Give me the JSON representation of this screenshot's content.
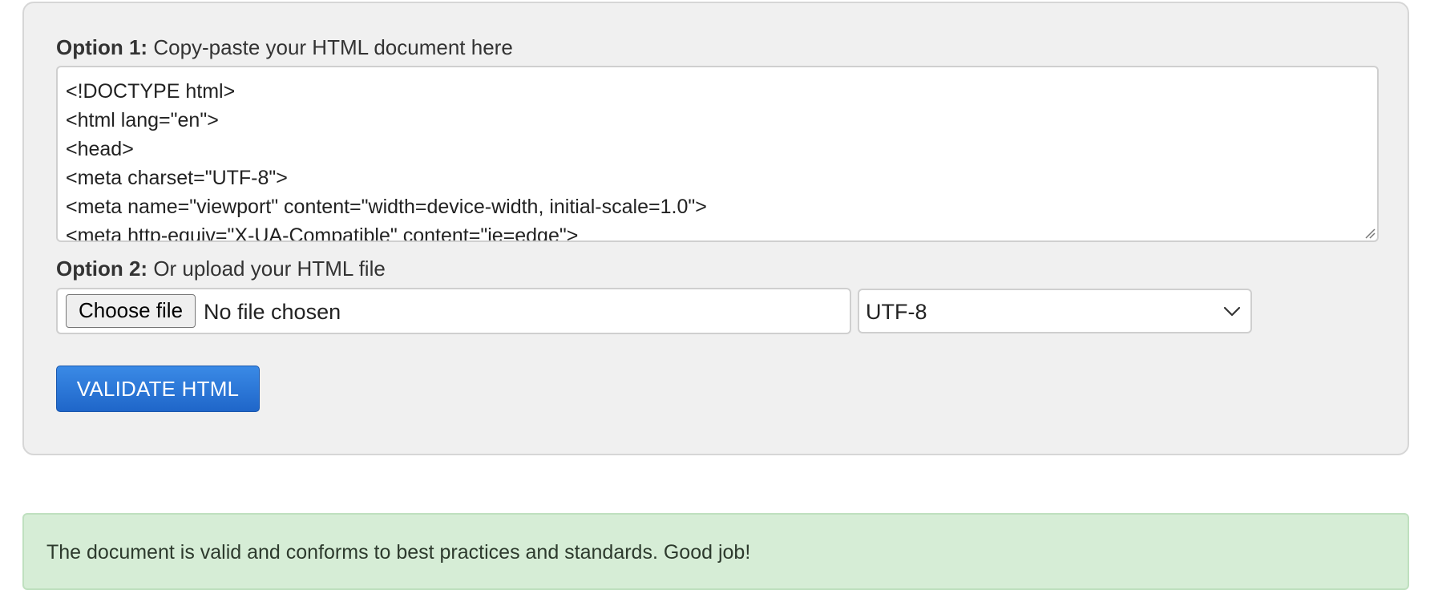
{
  "form": {
    "option1": {
      "prefix": "Option 1:",
      "text": "Copy-paste your HTML document here"
    },
    "textarea": {
      "lines": [
        "<!DOCTYPE html>",
        "<html lang=\"en\">",
        "<head>",
        "<meta charset=\"UTF-8\">",
        "<meta name=\"viewport\" content=\"width=device-width, initial-scale=1.0\">",
        "<meta http-equiv=\"X-UA-Compatible\" content=\"ie=edge\">"
      ]
    },
    "option2": {
      "prefix": "Option 2:",
      "text": "Or upload your HTML file"
    },
    "file_input": {
      "button_label": "Choose file",
      "status": "No file chosen"
    },
    "encoding": {
      "selected": "UTF-8"
    },
    "validate_label": "VALIDATE HTML"
  },
  "result": {
    "message": "The document is valid and conforms to best practices and standards. Good job!",
    "status_color": "#d6edd6"
  },
  "icons": {
    "select_arrow": "chevron-down-icon",
    "textarea_grip": "resize-grip-icon"
  },
  "colors": {
    "primary_button": "#2a77d8",
    "panel_background": "#f0f0f0"
  }
}
